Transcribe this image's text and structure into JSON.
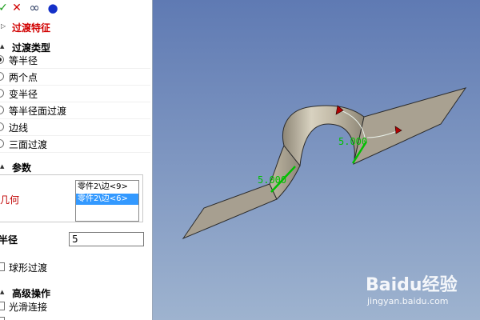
{
  "toolbar": {
    "confirm_icon": "checkmark-icon",
    "cancel_icon": "close-icon",
    "preview_icon": "preview-glasses-icon",
    "help_icon": "blue-dot-icon",
    "confirm_symbol": "✓",
    "cancel_symbol": "✕",
    "preview_symbol": "∞",
    "help_symbol": "●"
  },
  "feature": {
    "title": "过渡特征",
    "title_color": "#d10000"
  },
  "transition_type": {
    "heading": "过渡类型",
    "options": [
      {
        "label": "等半径",
        "selected": true
      },
      {
        "label": "两个点",
        "selected": false
      },
      {
        "label": "变半径",
        "selected": false
      },
      {
        "label": "等半径面过渡",
        "selected": false
      },
      {
        "label": "边线",
        "selected": false
      },
      {
        "label": "三面过渡",
        "selected": false
      }
    ]
  },
  "params": {
    "heading": "参数",
    "geometry_label": "几何",
    "geometry_label_color": "#c00000",
    "geometry_items": [
      {
        "text": "零件2\\边<9>",
        "selected": false
      },
      {
        "text": "零件2\\边<6>",
        "selected": true
      }
    ],
    "radius_label": "半径",
    "radius_value": "5",
    "spherical_label": "球形过渡"
  },
  "advanced": {
    "heading": "高级操作",
    "smooth_label": "光滑连接"
  },
  "viewport": {
    "dimension_left": "5.000",
    "dimension_right": "5.000",
    "dimension_color": "#00c000",
    "arrow_color": "#b00000"
  },
  "watermark": {
    "brand": "Baidu经验",
    "url": "jingyan.baidu.com"
  }
}
